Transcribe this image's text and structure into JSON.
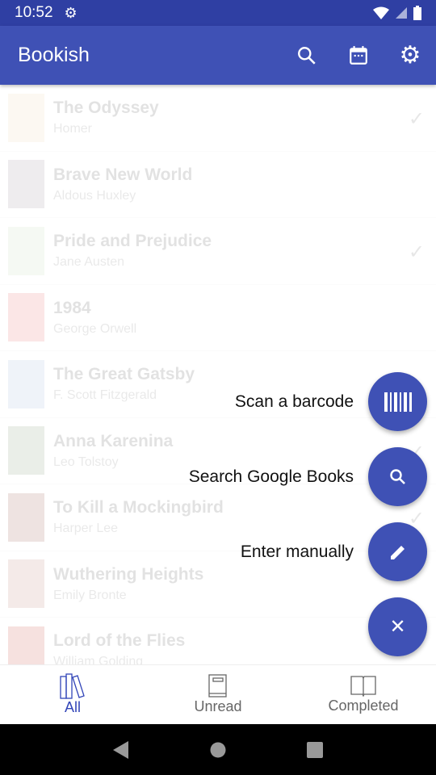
{
  "status": {
    "time": "10:52"
  },
  "appbar": {
    "title": "Bookish",
    "icons": [
      "search-icon",
      "calendar-icon",
      "settings-icon"
    ]
  },
  "books": [
    {
      "title": "The Odyssey",
      "author": "Homer",
      "completed": true,
      "cover": "#e8c9a0"
    },
    {
      "title": "Brave New World",
      "author": "Aldous Huxley",
      "completed": false,
      "cover": "#8a7a8a"
    },
    {
      "title": "Pride and Prejudice",
      "author": "Jane Austen",
      "completed": true,
      "cover": "#b9d4a8"
    },
    {
      "title": "1984",
      "author": "George Orwell",
      "completed": false,
      "cover": "#e05050"
    },
    {
      "title": "The Great Gatsby",
      "author": "F. Scott Fitzgerald",
      "completed": false,
      "cover": "#8fa8d0"
    },
    {
      "title": "Anna Karenina",
      "author": "Leo Tolstoy",
      "completed": true,
      "cover": "#6a8a5a"
    },
    {
      "title": "To Kill a Mockingbird",
      "author": "Harper Lee",
      "completed": true,
      "cover": "#8a3a2a"
    },
    {
      "title": "Wuthering Heights",
      "author": "Emily Bronte",
      "completed": false,
      "cover": "#b06a5a"
    },
    {
      "title": "Lord of the Flies",
      "author": "William Golding",
      "completed": false,
      "cover": "#c03020"
    }
  ],
  "fab_menu": {
    "scan": "Scan a barcode",
    "search": "Search Google Books",
    "manual": "Enter manually"
  },
  "bottom_nav": {
    "items": [
      {
        "label": "All",
        "active": true
      },
      {
        "label": "Unread",
        "active": false
      },
      {
        "label": "Completed",
        "active": false
      }
    ]
  },
  "colors": {
    "primary": "#3f51b5",
    "status_bar": "#2f3fa3"
  }
}
